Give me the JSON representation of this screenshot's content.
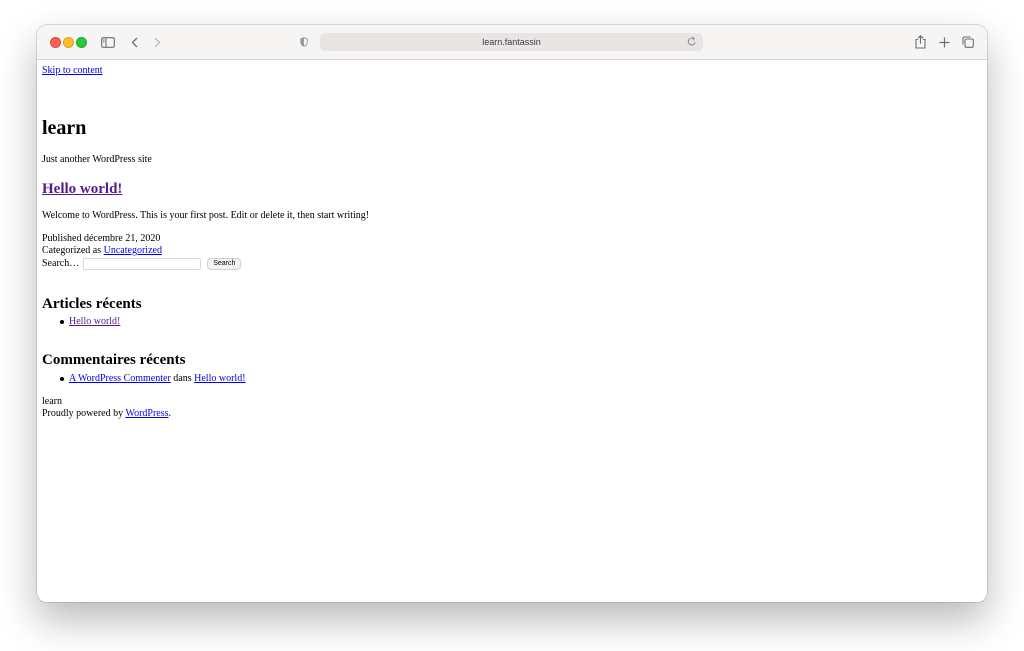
{
  "browser": {
    "url": "learn.fantassin"
  },
  "page": {
    "skip_link": "Skip to content",
    "site_title": "learn",
    "site_description": "Just another WordPress site",
    "post": {
      "title": "Hello world!",
      "excerpt": "Welcome to WordPress. This is your first post. Edit or delete it, then start writing!",
      "published_prefix": "Published",
      "published_date": "décembre 21, 2020",
      "category_prefix": "Categorized as",
      "category": "Uncategorized"
    },
    "search": {
      "label": "Search…",
      "button": "Search"
    },
    "recent_posts": {
      "heading": "Articles récents",
      "items": [
        "Hello world!"
      ]
    },
    "recent_comments": {
      "heading": "Commentaires récents",
      "author": "A WordPress Commenter",
      "joiner": "dans",
      "post": "Hello world!"
    },
    "footer": {
      "site_name": "learn",
      "powered_prefix": "Proudly powered by",
      "powered_link": "WordPress",
      "powered_suffix": "."
    }
  },
  "icons": {
    "sidebar": "sidebar-icon",
    "back": "chevron-left-icon",
    "forward": "chevron-right-icon",
    "shield": "privacy-shield-icon",
    "reload": "reload-icon",
    "share": "share-icon",
    "new_tab": "plus-icon",
    "tabs": "tab-overview-icon"
  }
}
